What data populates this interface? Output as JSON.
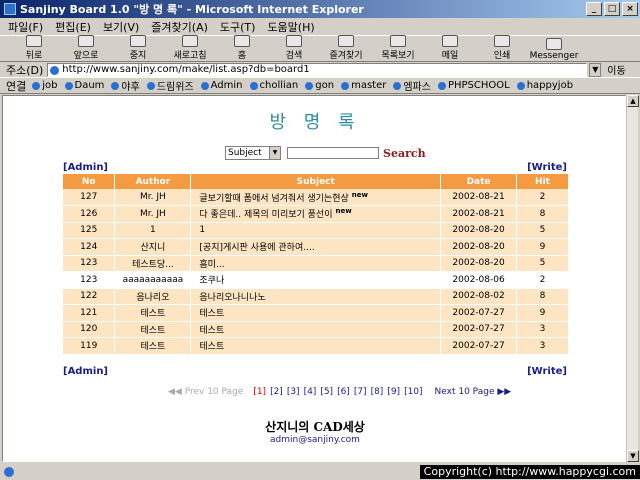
{
  "window": {
    "title": "Sanjiny Board 1.0 \"방 명 록\" - Microsoft Internet Explorer",
    "min": "_",
    "max": "□",
    "close": "×"
  },
  "menu": [
    "파일(F)",
    "편집(E)",
    "보기(V)",
    "즐겨찾기(A)",
    "도구(T)",
    "도움말(H)"
  ],
  "toolbar": [
    "뒤로",
    "앞으로",
    "중지",
    "새로고침",
    "홈",
    "검색",
    "즐겨찾기",
    "목록보기",
    "메일",
    "인쇄",
    "Messenger"
  ],
  "address": {
    "label": "주소(D)",
    "url": "http://www.sanjiny.com/make/list.asp?db=board1",
    "go": "이동"
  },
  "links": {
    "label": "연결",
    "items": [
      "job",
      "Daum",
      "야후",
      "드림위즈",
      "Admin",
      "chollian",
      "gon",
      "master",
      "엠파스",
      "PHPSCHOOL",
      "happyjob"
    ]
  },
  "page": {
    "title": "방 명 록",
    "search": {
      "select_value": "Subject",
      "button": "Search"
    },
    "admin": "[Admin]",
    "write": "[Write]",
    "columns": [
      "No",
      "Author",
      "Subject",
      "Date",
      "Hit"
    ],
    "rows": [
      {
        "no": "127",
        "author": "Mr. JH",
        "subject": "글보기할때 폼에서 넘겨줘서 생기는현상",
        "new": "new",
        "date": "2002-08-21",
        "hit": "2"
      },
      {
        "no": "126",
        "author": "Mr. JH",
        "subject": "다 좋은데.. 제목의 미리보기 풍선이",
        "new": "new",
        "date": "2002-08-21",
        "hit": "8"
      },
      {
        "no": "125",
        "author": "1",
        "subject": "1",
        "new": "",
        "date": "2002-08-20",
        "hit": "5"
      },
      {
        "no": "124",
        "author": "산지니",
        "subject": "[공지]게시판 사용에 관하여....",
        "new": "",
        "date": "2002-08-20",
        "hit": "9"
      },
      {
        "no": "123",
        "author": "테스트당...",
        "subject": "흠미...",
        "new": "",
        "date": "2002-08-20",
        "hit": "5"
      },
      {
        "no": "123",
        "author": "aaaaaaaaaaa",
        "subject": "조쿠나",
        "new": "",
        "date": "2002-08-06",
        "hit": "2"
      },
      {
        "no": "122",
        "author": "음나리오",
        "subject": "음나리오나니나노",
        "new": "",
        "date": "2002-08-02",
        "hit": "8"
      },
      {
        "no": "121",
        "author": "테스트",
        "subject": "테스트",
        "new": "",
        "date": "2002-07-27",
        "hit": "9"
      },
      {
        "no": "120",
        "author": "테스트",
        "subject": "테스트",
        "new": "",
        "date": "2002-07-27",
        "hit": "3"
      },
      {
        "no": "119",
        "author": "테스트",
        "subject": "테스트",
        "new": "",
        "date": "2002-07-27",
        "hit": "3"
      }
    ],
    "pager": {
      "prev": "◀◀ Prev 10 Page",
      "pages": [
        "[1]",
        "[2]",
        "[3]",
        "[4]",
        "[5]",
        "[6]",
        "[7]",
        "[8]",
        "[9]",
        "[10]"
      ],
      "next": "Next 10 Page ▶▶"
    },
    "footer_name": "산지니의 CAD세상",
    "footer_email": "admin@sanjiny.com"
  },
  "status": {
    "copyright": "Copyright(c) http://www.happycgi.com"
  }
}
